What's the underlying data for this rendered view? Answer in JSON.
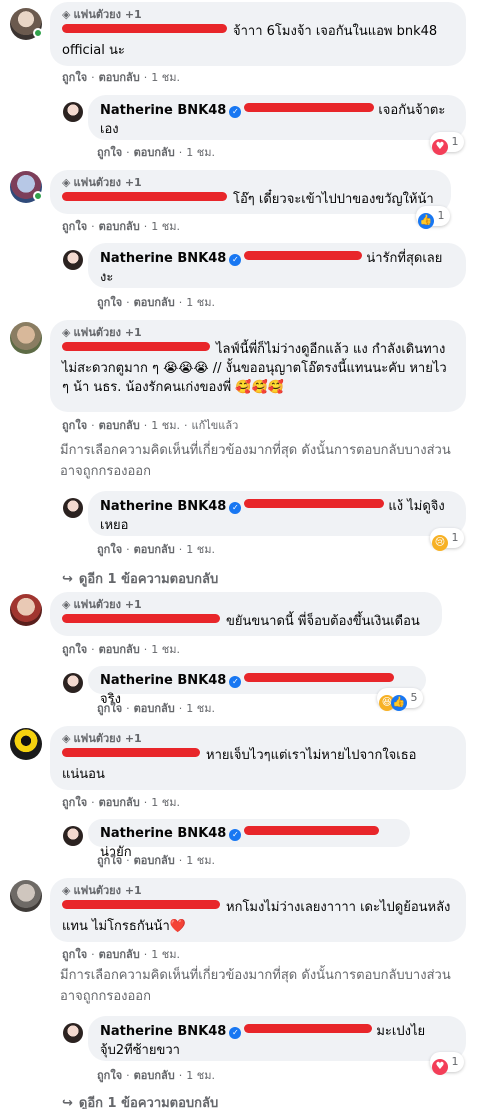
{
  "labels": {
    "fan_badge": "แฟนตัวยง +1",
    "like": "ถูกใจ",
    "reply": "ตอบกลับ",
    "time": "1 ชม.",
    "edited": "แก้ไขแล้ว",
    "filter_notice": "มีการเลือกความคิดเห็นที่เกี่ยวข้องมากที่สุด ดังนั้นการตอบกลับบางส่วนอาจถูกกรองออก",
    "view_replies": "ดูอีก 1 ข้อความตอบกลับ",
    "page_name": "Natherine BNK48",
    "dot": "·"
  },
  "comments": [
    {
      "text": "จ้าาา 6โมงจ้า เจอกันในแอพ bnk48 official นะ",
      "reply_text": "เจอกันจ้าตะเอง",
      "reply_reaction": {
        "icon": "heart",
        "count": "1"
      }
    },
    {
      "text": "โอ๊ๆ เดี๋ยวจะเข้าไปปาของขวัญให้น้า",
      "comment_reaction": {
        "icon": "like",
        "count": "1"
      },
      "reply_text": "น่ารักที่สุดเลยงะ"
    },
    {
      "text": "ไลฟ์นี้พี่ก็ไม่ว่างดูอีกแล้ว แง กำลังเดินทางไม่สะดวกตูมาก ๆ 😭😭😭 // งั้นขออนุญาตโอ๊ตรงนี้แทนนะคับ หายไว ๆ น้า นธร. น้องรักคนเก่งของพี่ 🥰🥰🥰",
      "reply_text": "แง้ ไม่ดูจิงเหยอ",
      "reply_reaction": {
        "icon": "sad",
        "count": "1"
      }
    },
    {
      "text": "ขยันขนาดนี้ พี่จ็อบต้องขึ้นเงินเดือน",
      "reply_text": "จริง",
      "reply_reaction": {
        "icon": "haha-like",
        "count": "5"
      }
    },
    {
      "text": "หายเจ็บไวๆแต่เราไม่หายไปจากใจเธอแน่นอน",
      "reply_text": "น่ายัก"
    },
    {
      "text": "หกโมงไม่ว่างเลยงาาาา เดะไปดูย้อนหลังแทน ไม่โกรธกันน้า❤️",
      "reply_text": "มะเปงไย จุ้บ2ทีซ้ายขวา",
      "reply_reaction": {
        "icon": "heart",
        "count": "1"
      }
    }
  ]
}
